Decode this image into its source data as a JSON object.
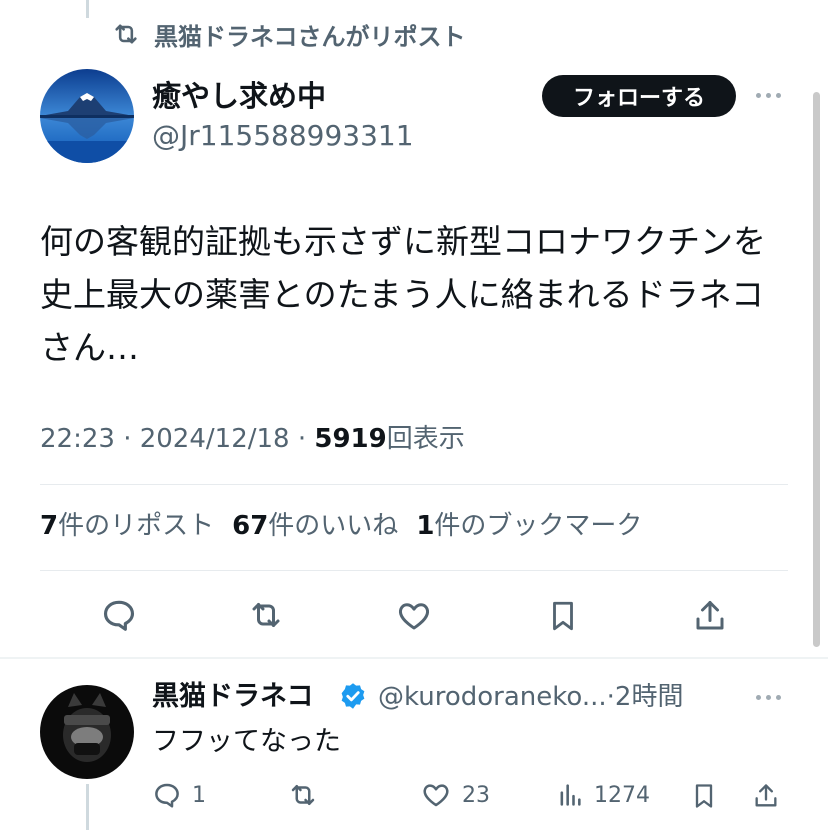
{
  "repost_header": {
    "text": "黒猫ドラネコさんがリポスト"
  },
  "tweet": {
    "display_name": "癒やし求め中",
    "handle": "@Jr115588993311",
    "follow_label": "フォローする",
    "body_lines": [
      "何の客観的証拠も示さずに新型コロナワクチンを",
      "史上最大の薬害とのたまう人に絡まれるドラネコ",
      "さん…"
    ],
    "meta": {
      "time_date": "22:23 · 2024/12/18 · ",
      "views": "5919",
      "views_label": "回表示"
    },
    "stats": [
      {
        "num": "7",
        "label": "件のリポスト"
      },
      {
        "num": "67",
        "label": "件のいいね"
      },
      {
        "num": "1",
        "label": "件のブックマーク"
      }
    ]
  },
  "reply": {
    "display_name": "黒猫ドラネコ",
    "handle_time": "@kurodoraneko...·2時間",
    "text": "フフッてなった",
    "actions": {
      "replies": "1",
      "likes": "23",
      "views": "1274"
    }
  },
  "colors": {
    "text": "#0f1419",
    "secondary": "#536471",
    "verified": "#1d9bf0",
    "button": "#0f1419"
  },
  "icons": [
    "repost-icon",
    "more-icon",
    "reply-icon",
    "like-icon",
    "bookmark-icon",
    "share-icon",
    "views-icon",
    "verified-badge-icon"
  ]
}
